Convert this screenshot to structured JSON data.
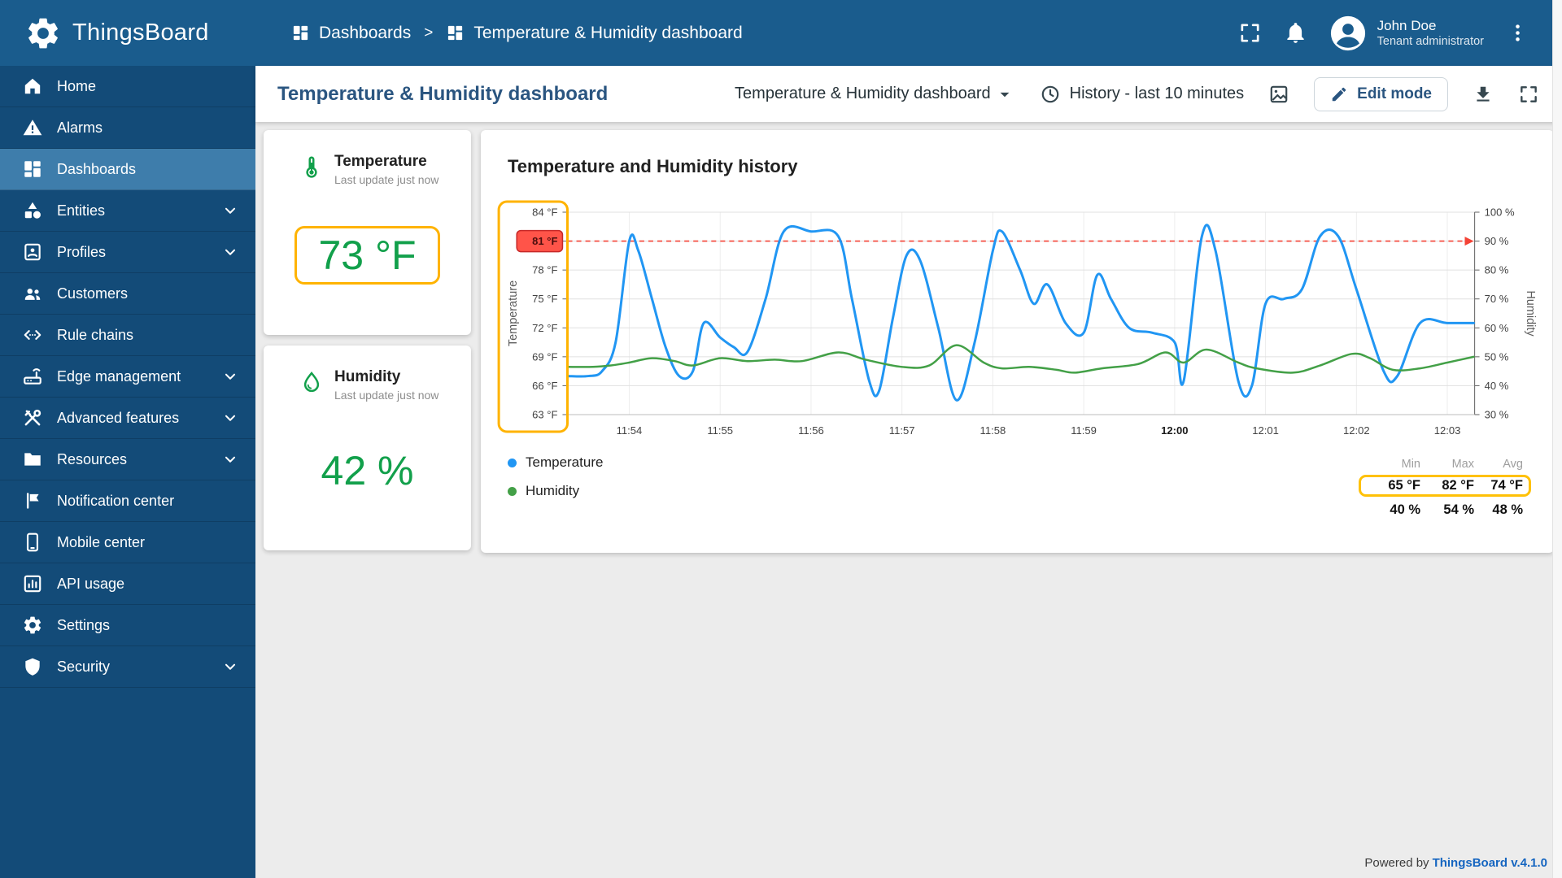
{
  "app": {
    "name": "ThingsBoard",
    "powered_by": "Powered by",
    "version_link": "ThingsBoard v.4.1.0"
  },
  "header": {
    "breadcrumb": {
      "root": "Dashboards",
      "separator": ">",
      "current": "Temperature & Humidity dashboard"
    },
    "action_icons": [
      "fullscreen-icon",
      "bell-icon",
      "avatar",
      "kebab-menu-icon"
    ],
    "user": {
      "name": "John Doe",
      "role": "Tenant administrator"
    }
  },
  "sidebar": {
    "items": [
      {
        "label": "Home",
        "icon": "home",
        "active": false,
        "expandable": false
      },
      {
        "label": "Alarms",
        "icon": "alarms",
        "active": false,
        "expandable": false
      },
      {
        "label": "Dashboards",
        "icon": "dashboards",
        "active": true,
        "expandable": false
      },
      {
        "label": "Entities",
        "icon": "entities",
        "active": false,
        "expandable": true
      },
      {
        "label": "Profiles",
        "icon": "profiles",
        "active": false,
        "expandable": true
      },
      {
        "label": "Customers",
        "icon": "customers",
        "active": false,
        "expandable": false
      },
      {
        "label": "Rule chains",
        "icon": "rule-chains",
        "active": false,
        "expandable": false
      },
      {
        "label": "Edge management",
        "icon": "edge",
        "active": false,
        "expandable": true
      },
      {
        "label": "Advanced features",
        "icon": "advanced",
        "active": false,
        "expandable": true
      },
      {
        "label": "Resources",
        "icon": "resources",
        "active": false,
        "expandable": true
      },
      {
        "label": "Notification center",
        "icon": "notification",
        "active": false,
        "expandable": false
      },
      {
        "label": "Mobile center",
        "icon": "mobile",
        "active": false,
        "expandable": false
      },
      {
        "label": "API usage",
        "icon": "api-usage",
        "active": false,
        "expandable": false
      },
      {
        "label": "Settings",
        "icon": "settings",
        "active": false,
        "expandable": false
      },
      {
        "label": "Security",
        "icon": "security",
        "active": false,
        "expandable": true
      }
    ]
  },
  "toolbar": {
    "title": "Temperature & Humidity dashboard",
    "dashboard_select": "Temperature & Humidity dashboard",
    "time_window": "History - last 10 minutes",
    "edit_button": "Edit mode"
  },
  "cards": {
    "temperature": {
      "title": "Temperature",
      "subtitle": "Last update just now",
      "value": "73 °F"
    },
    "humidity": {
      "title": "Humidity",
      "subtitle": "Last update just now",
      "value": "42 %"
    }
  },
  "chart_card": {
    "title": "Temperature and Humidity history",
    "legend": [
      {
        "label": "Temperature",
        "color": "#2196f3"
      },
      {
        "label": "Humidity",
        "color": "#43a047"
      }
    ],
    "stats": {
      "headers": [
        "Min",
        "Max",
        "Avg"
      ],
      "rows": [
        {
          "name": "Temperature",
          "values": [
            "65 °F",
            "82 °F",
            "74 °F"
          ],
          "highlighted": true
        },
        {
          "name": "Humidity",
          "values": [
            "40 %",
            "54 %",
            "48 %"
          ],
          "highlighted": false
        }
      ]
    }
  },
  "chart_data": {
    "type": "line",
    "title": "Temperature and Humidity history",
    "x_labels": [
      "11:54",
      "11:55",
      "11:56",
      "11:57",
      "11:58",
      "11:59",
      "12:00",
      "12:01",
      "12:02",
      "12:03"
    ],
    "x_bold_label": "12:00",
    "left_axis": {
      "label": "Temperature",
      "unit": "°F",
      "ticks": [
        84,
        81,
        78,
        75,
        72,
        69,
        66,
        63
      ],
      "range": [
        63,
        84
      ],
      "highlight_tick": 81
    },
    "right_axis": {
      "label": "Humidity",
      "unit": "%",
      "ticks": [
        100,
        90,
        80,
        70,
        60,
        50,
        40,
        30
      ],
      "range": [
        30,
        100
      ]
    },
    "threshold": {
      "value": 81,
      "color": "#f44336"
    },
    "grid": true,
    "legend_position": "bottom-left",
    "series": [
      {
        "name": "Temperature",
        "axis": "left",
        "color": "#2196f3",
        "x": [
          -0.68,
          -0.45,
          -0.3,
          -0.15,
          0,
          0.1,
          0.25,
          0.4,
          0.55,
          0.7,
          0.82,
          1,
          1.15,
          1.3,
          1.5,
          1.7,
          2,
          2.3,
          2.45,
          2.64,
          2.75,
          2.9,
          3.05,
          3.2,
          3.4,
          3.6,
          3.8,
          4,
          4.1,
          4.3,
          4.45,
          4.6,
          4.8,
          5,
          5.15,
          5.3,
          5.5,
          5.75,
          6,
          6.1,
          6.3,
          6.45,
          6.7,
          6.85,
          7,
          7.2,
          7.4,
          7.6,
          7.8,
          8,
          8.3,
          8.45,
          8.7,
          9,
          9.29
        ],
        "values": [
          67,
          67,
          67.5,
          70.5,
          81,
          80,
          75,
          70,
          67,
          67.5,
          72.5,
          71,
          70,
          69.5,
          75,
          82,
          82,
          81.5,
          75,
          66.5,
          65.5,
          73,
          79.5,
          79,
          72,
          64.5,
          70.5,
          80,
          82,
          78,
          74.5,
          76.5,
          72.5,
          71.5,
          77.5,
          75,
          72,
          71.5,
          70.5,
          66.5,
          81.5,
          80,
          66.5,
          66,
          74.5,
          75,
          76,
          81.5,
          81.5,
          76,
          67.5,
          67,
          72.5,
          72.5,
          72.5
        ]
      },
      {
        "name": "Humidity",
        "axis": "right",
        "color": "#43a047",
        "x": [
          -0.68,
          -0.4,
          -0.2,
          0,
          0.25,
          0.5,
          0.7,
          1,
          1.3,
          1.6,
          1.9,
          2.3,
          2.6,
          3,
          3.3,
          3.6,
          3.9,
          4.1,
          4.4,
          4.7,
          4.9,
          5.2,
          5.6,
          5.9,
          6.1,
          6.35,
          6.7,
          6.9,
          7.3,
          7.6,
          7.95,
          8.15,
          8.4,
          8.7,
          9,
          9.29
        ],
        "values": [
          46.5,
          46.5,
          47,
          48,
          49.5,
          48.5,
          47,
          49.5,
          48.5,
          49,
          48.5,
          51.5,
          49,
          46.5,
          47,
          54,
          48,
          46,
          46.5,
          45.5,
          44.5,
          46,
          47.5,
          51.5,
          48,
          52.5,
          48,
          46,
          44.5,
          47,
          51,
          49.5,
          45.5,
          46,
          48,
          50
        ]
      }
    ]
  },
  "colors": {
    "header_bg": "#1a5c8d",
    "sidebar_bg": "#134b78",
    "sidebar_active": "#3e7dab",
    "value_green": "#12a04b",
    "highlight_orange": "#ffb300",
    "highlight_yellow": "#ffc107",
    "threshold_red": "#f44336",
    "link_blue": "#1565c0"
  }
}
